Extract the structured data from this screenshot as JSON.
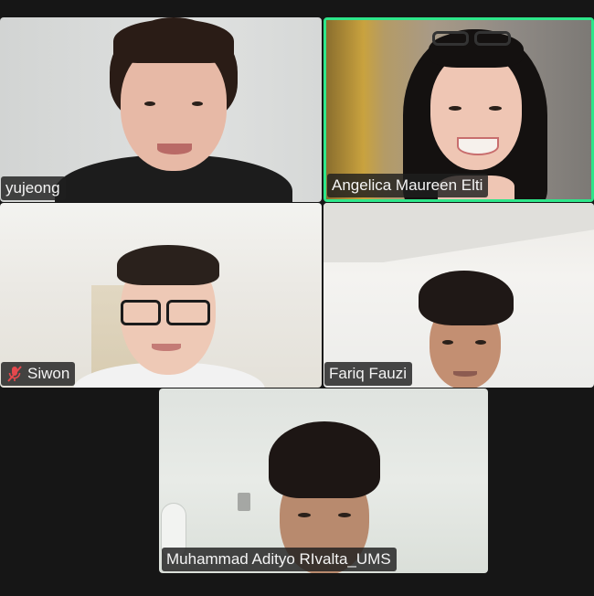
{
  "participants": [
    {
      "name": "yujeong",
      "muted": false,
      "active_speaker": false
    },
    {
      "name": "Angelica Maureen Elti",
      "muted": false,
      "active_speaker": true
    },
    {
      "name": "Siwon",
      "muted": true,
      "active_speaker": false
    },
    {
      "name": "Fariq Fauzi",
      "muted": false,
      "active_speaker": false
    },
    {
      "name": "Muhammad Adityo RIvalta_UMS",
      "muted": false,
      "active_speaker": false
    }
  ],
  "colors": {
    "background": "#161616",
    "active_speaker_border": "#2ee68a",
    "muted_icon": "#e5484d",
    "name_tag_bg": "#1e1e1e"
  },
  "icons": {
    "mute": "microphone-muted-icon"
  }
}
